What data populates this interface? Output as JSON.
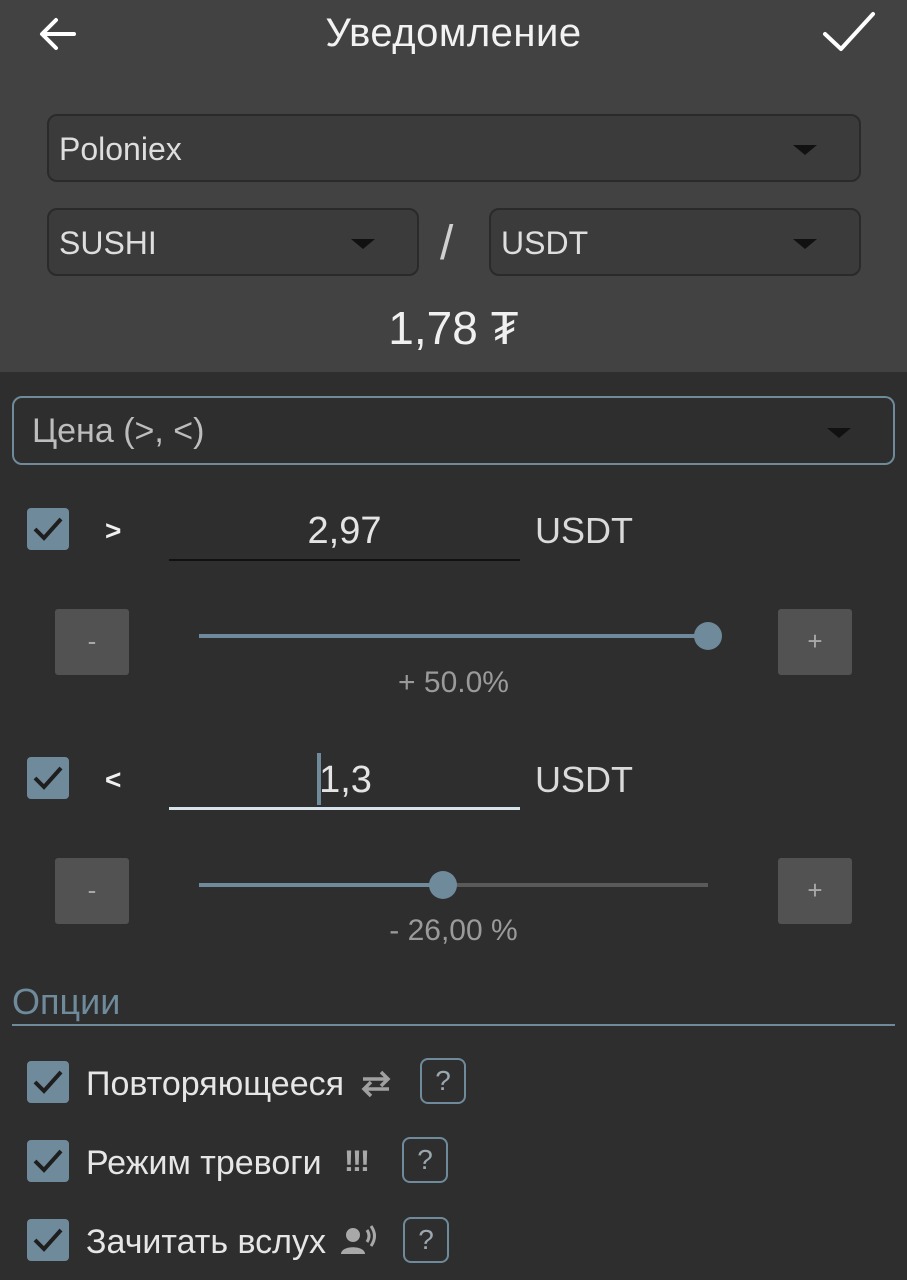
{
  "header": {
    "title": "Уведомление"
  },
  "exchange": {
    "selected": "Poloniex"
  },
  "pair": {
    "base": "SUSHI",
    "separator": "/",
    "quote": "USDT"
  },
  "current_price": "1,78 ₮",
  "condition": {
    "selected": "Цена (>, <)"
  },
  "upper": {
    "checked": true,
    "operator": ">",
    "value": "2,97",
    "unit": "USDT",
    "minus_label": "-",
    "plus_label": "+",
    "slider_fraction": 1.0,
    "percent_text": "+ 50.0%"
  },
  "lower": {
    "checked": true,
    "operator": "<",
    "value": "1,3",
    "unit": "USDT",
    "minus_label": "-",
    "plus_label": "+",
    "slider_fraction": 0.48,
    "percent_text": "- 26,00 %"
  },
  "options": {
    "title": "Опции",
    "items": [
      {
        "label": "Повторяющееся",
        "checked": true,
        "icon": "repeat-icon",
        "help": "?"
      },
      {
        "label": "Режим тревоги",
        "checked": true,
        "icon": "alarm-exclamation-icon",
        "icon_text": "!!!",
        "help": "?"
      },
      {
        "label": "Зачитать вслух",
        "checked": true,
        "icon": "speak-icon",
        "help": "?"
      }
    ]
  },
  "colors": {
    "accent": "#6f8a9b",
    "header_bg": "#424242",
    "body_bg": "#2e2e2e"
  }
}
